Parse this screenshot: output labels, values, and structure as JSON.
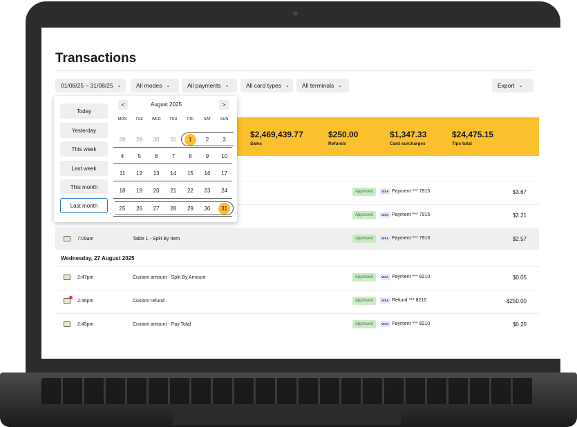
{
  "page": {
    "title": "Transactions",
    "filters": [
      {
        "label": "01/08/25 – 31/08/25"
      },
      {
        "label": "All modes"
      },
      {
        "label": "All payments"
      },
      {
        "label": "All card types"
      },
      {
        "label": "All terminals"
      }
    ],
    "export_label": "Export"
  },
  "summary": [
    {
      "value": "$2,469,439.77",
      "label": "Sales"
    },
    {
      "value": "$250.00",
      "label": "Refunds"
    },
    {
      "value": "$1,347.33",
      "label": "Card surcharges"
    },
    {
      "value": "$24,475.15",
      "label": "Tips total"
    }
  ],
  "datepicker": {
    "presets": [
      "Today",
      "Yesterday",
      "This week",
      "Last week",
      "This month",
      "Last month"
    ],
    "month_label": "August 2025",
    "prev": "<",
    "next": ">",
    "weekdays": [
      "MON",
      "TUE",
      "WED",
      "THU",
      "FRI",
      "SAT",
      "SUN"
    ],
    "weeks": [
      [
        "28",
        "29",
        "30",
        "31",
        "1",
        "2",
        "3"
      ],
      [
        "4",
        "5",
        "6",
        "7",
        "8",
        "9",
        "10"
      ],
      [
        "11",
        "12",
        "13",
        "14",
        "15",
        "16",
        "17"
      ],
      [
        "18",
        "19",
        "20",
        "21",
        "22",
        "23",
        "24"
      ],
      [
        "25",
        "26",
        "27",
        "28",
        "29",
        "30",
        "31"
      ]
    ]
  },
  "transactions": {
    "row1": {
      "status": "Approved",
      "card": "VISA",
      "payment": "Payment *** 7915",
      "amount": "$3.67"
    },
    "row2": {
      "status": "Approved",
      "card": "VISA",
      "payment": "Payment *** 7915",
      "amount": "$2.21"
    },
    "row3": {
      "time": "7:09am",
      "description": "Table 1 - Split By Item",
      "status": "Approved",
      "card": "VISA",
      "payment": "Payment *** 7915",
      "amount": "$2.57"
    },
    "day_header": "Wednesday, 27 August 2025",
    "row4": {
      "time": "2:47pm",
      "description": "Custom amount - Split By Amount",
      "status": "Approved",
      "card": "VISA",
      "payment": "Payment *** 8210",
      "amount": "$0.05"
    },
    "row5": {
      "time": "2:46pm",
      "description": "Custom refund",
      "status": "Approved",
      "card": "VISA",
      "payment": "Refund *** 8210",
      "amount": "-$250.00"
    },
    "row6": {
      "time": "2:45pm",
      "description": "Custom amount - Pay Total",
      "status": "Approved",
      "card": "VISA",
      "payment": "Payment *** 8210",
      "amount": "$0.25"
    }
  },
  "colors": {
    "accent": "#fbc02d",
    "approved_bg": "#cde9c9",
    "selected_border": "#1976d2"
  }
}
